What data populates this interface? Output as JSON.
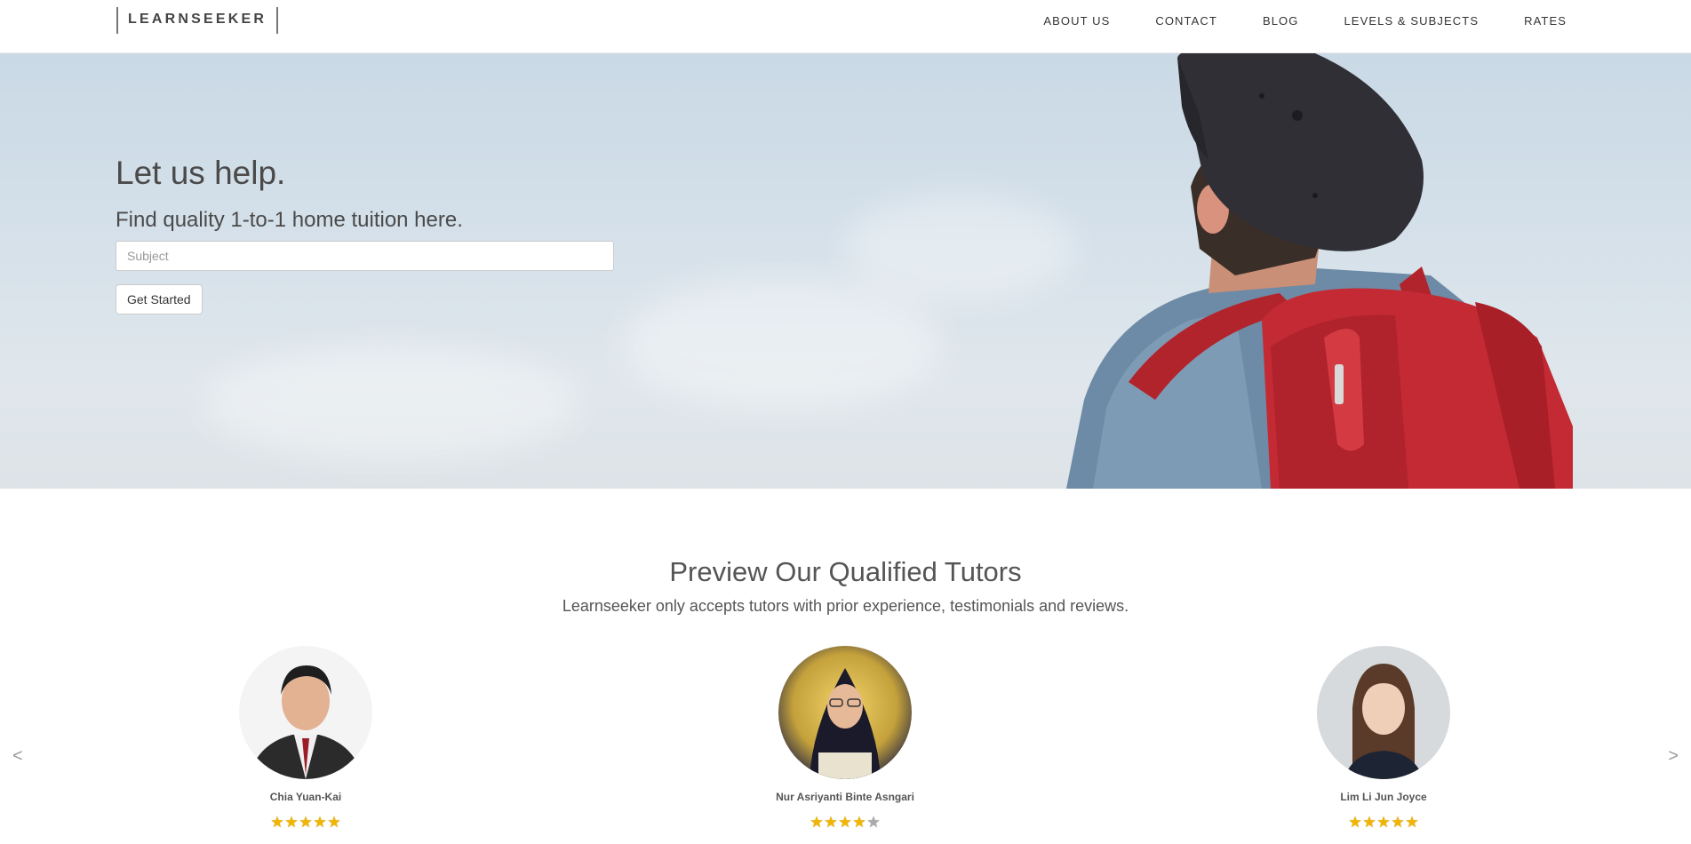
{
  "nav": {
    "logo": "LEARNSEEKER",
    "links": [
      "ABOUT US",
      "CONTACT",
      "BLOG",
      "LEVELS & SUBJECTS",
      "RATES"
    ]
  },
  "hero": {
    "title": "Let us help.",
    "subtitle": "Find quality 1-to-1 home tuition here.",
    "subject_placeholder": "Subject",
    "cta_label": "Get Started"
  },
  "tutors_section": {
    "title": "Preview Our Qualified Tutors",
    "subtitle": "Learnseeker only accepts tutors with prior experience, testimonials and reviews.",
    "prev": "<",
    "next": ">",
    "tutors": [
      {
        "name": "Chia Yuan-Kai",
        "rating": 5
      },
      {
        "name": "Nur Asriyanti Binte Asngari",
        "rating": 4.5
      },
      {
        "name": "Lim Li Jun Joyce",
        "rating": 4.5
      }
    ]
  },
  "colors": {
    "sky": "#d6e1ea",
    "backpack": "#c42a33",
    "star": "#f1b500"
  }
}
